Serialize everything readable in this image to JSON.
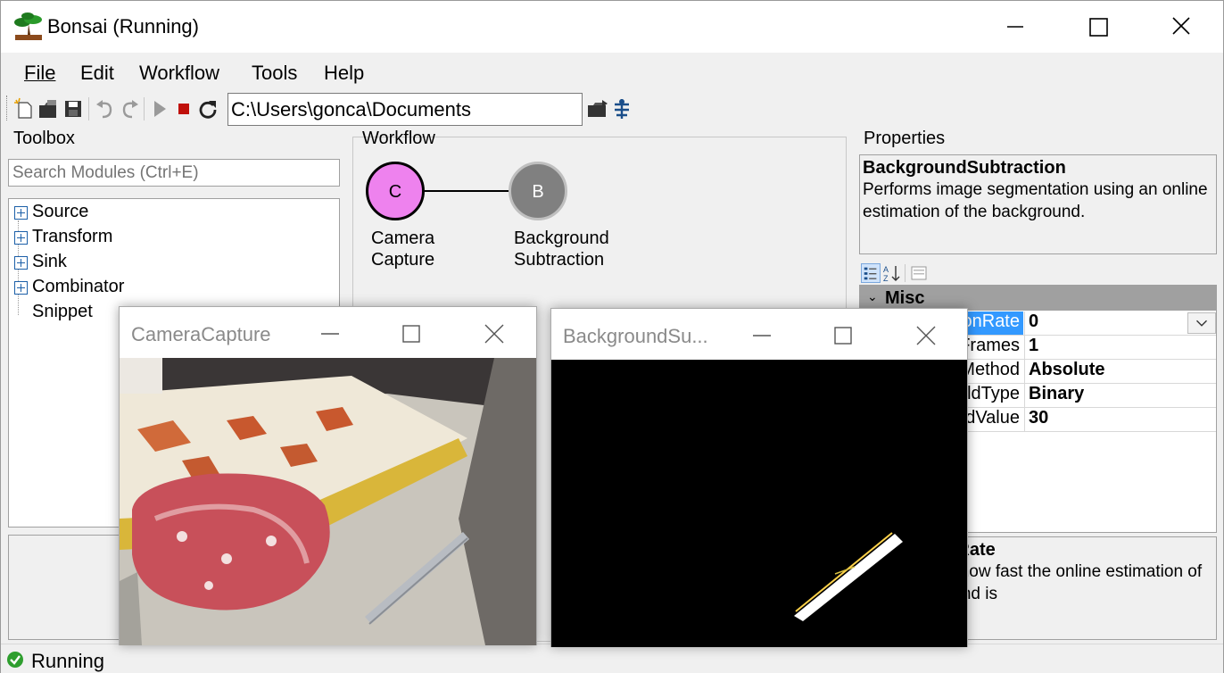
{
  "window": {
    "title": "Bonsai (Running)"
  },
  "menu": {
    "file": "File",
    "edit": "Edit",
    "workflow": "Workflow",
    "tools": "Tools",
    "help": "Help"
  },
  "toolbar": {
    "path": "C:\\Users\\gonca\\Documents"
  },
  "toolbox": {
    "title": "Toolbox",
    "search_placeholder": "Search Modules (Ctrl+E)",
    "items": [
      "Source",
      "Transform",
      "Sink",
      "Combinator",
      "Snippet"
    ]
  },
  "workflow": {
    "title": "Workflow",
    "nodes": [
      {
        "letter": "C",
        "label": "Camera\nCapture",
        "color": "#ee82ee"
      },
      {
        "letter": "B",
        "label": "Background\nSubtraction",
        "color": "#808080"
      }
    ]
  },
  "properties": {
    "title": "Properties",
    "selected_name": "BackgroundSubtraction",
    "selected_description": "Performs image segmentation using an online estimation of the background.",
    "category": "Misc",
    "rows": [
      {
        "name": "AdaptationRate",
        "value": "0"
      },
      {
        "name": "BackgroundFrames",
        "value": "1"
      },
      {
        "name": "SubtractionMethod",
        "value": "Absolute"
      },
      {
        "name": "ThresholdType",
        "value": "Binary"
      },
      {
        "name": "ThresholdValue",
        "value": "30"
      }
    ],
    "help_title": "AdaptationRate",
    "help_text": "Gets or sets how fast the online estimation of the background is"
  },
  "status": {
    "text": "Running"
  },
  "camera_window": {
    "title": "CameraCapture"
  },
  "bgsub_window": {
    "title": "BackgroundSu..."
  },
  "colors": {
    "accent_select": "#3399ff",
    "status_ok": "#2e9e2e",
    "stop_red": "#c0100a"
  }
}
